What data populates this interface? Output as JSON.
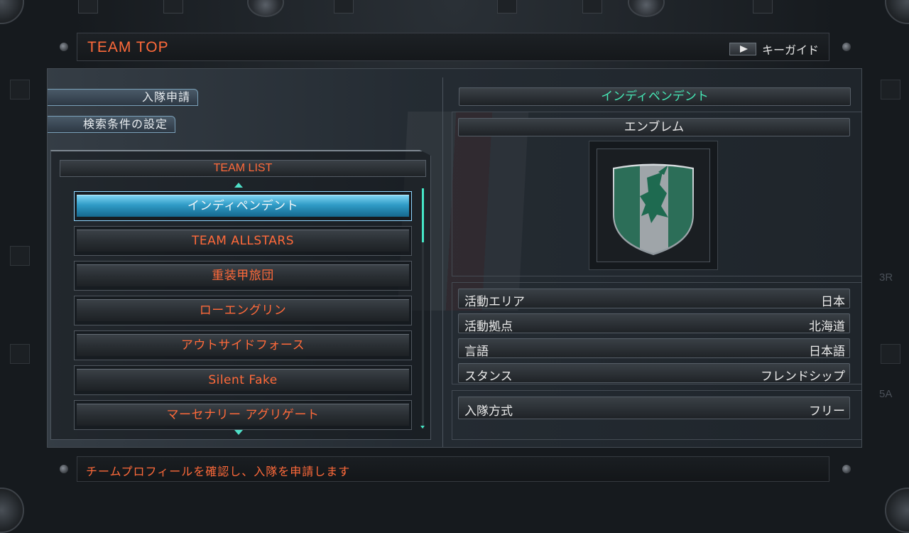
{
  "header": {
    "title": "TEAM TOP",
    "keyguide_label": "キーガイド"
  },
  "side_buttons": {
    "join_request": "入隊申請",
    "search_settings": "検索条件の設定"
  },
  "team_list": {
    "header": "TEAM LIST",
    "items": [
      "インディペンデント",
      "TEAM ALLSTARS",
      "重装甲旅団",
      "ローエングリン",
      "アウトサイドフォース",
      "Silent Fake",
      "マーセナリー アグリゲート"
    ],
    "selected_index": 0
  },
  "detail": {
    "team_name": "インディペンデント",
    "emblem_label": "エンブレム",
    "info": [
      {
        "key": "活動エリア",
        "value": "日本"
      },
      {
        "key": "活動拠点",
        "value": "北海道"
      },
      {
        "key": "言語",
        "value": "日本語"
      },
      {
        "key": "スタンス",
        "value": "フレンドシップ"
      }
    ],
    "join_method": {
      "key": "入隊方式",
      "value": "フリー"
    }
  },
  "footer": {
    "message": "チームプロフィールを確認し、入隊を申請します"
  },
  "side_labels": {
    "right_top": "3R",
    "right_bottom": "5A"
  },
  "colors": {
    "accent_orange": "#ff6a3a",
    "accent_green": "#46e6b4",
    "selected_blue": "#2f9bc6"
  }
}
